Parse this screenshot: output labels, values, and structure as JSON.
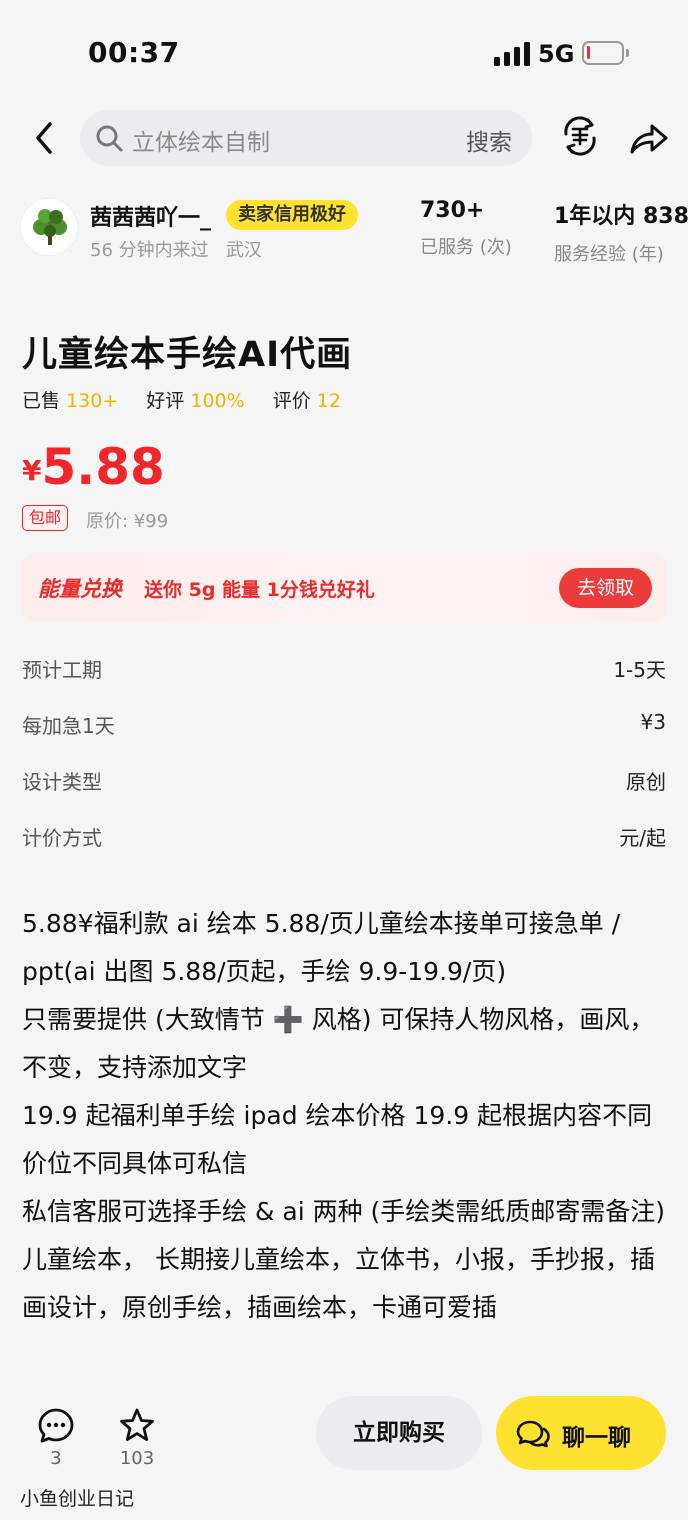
{
  "status_bar": {
    "time": "00:37",
    "network": "5G",
    "battery_level": 0.1
  },
  "search": {
    "placeholder": "立体绘本自制",
    "button_label": "搜索"
  },
  "seller": {
    "name": "茜茜茜吖一_",
    "credit_badge": "卖家信用极好",
    "last_seen": "56 分钟内来过",
    "location": "武汉",
    "served_value": "730+",
    "served_label": "已服务 (次)",
    "experience_value": "1年以内 838",
    "experience_label": "服务经验 (年)"
  },
  "product": {
    "title": "儿童绘本手绘AI代画",
    "sold_label": "已售",
    "sold_value": "130+",
    "rating_label": "好评",
    "rating_value": "100%",
    "reviews_label": "评价",
    "reviews_value": "12",
    "currency": "¥",
    "price": "5.88",
    "free_shipping": "包邮",
    "original_price": "原价: ¥99"
  },
  "energy": {
    "brand": "能量兑换",
    "desc": "送你 5g 能量 1分钱兑好礼",
    "claim_label": "去领取"
  },
  "properties": [
    {
      "key": "预计工期",
      "value": "1-5天"
    },
    {
      "key": "每加急1天",
      "value": "¥3"
    },
    {
      "key": "设计类型",
      "value": "原创"
    },
    {
      "key": "计价方式",
      "value": "元/起"
    }
  ],
  "description": [
    "5.88¥福利款 ai 绘本 5.88/页儿童绘本接单可接急单 / ppt(ai 出图 5.88/页起，手绘 9.9-19.9/页)",
    "只需要提供 (大致情节 ➕ 风格) 可保持人物风格，画风，不变，支持添加文字",
    "19.9 起福利单手绘 ipad 绘本价格 19.9 起根据内容不同价位不同具体可私信",
    "私信客服可选择手绘 & ai 两种 (手绘类需纸质邮寄需备注)",
    "儿童绘本， 长期接儿童绘本，立体书，小报，手抄报，插画设计，原创手绘，插画绘本，卡通可爱插"
  ],
  "bottom": {
    "comments_count": "3",
    "favorites_count": "103",
    "buy_label": "立即购买",
    "chat_label": "聊一聊",
    "watermark": "小鱼创业日记"
  },
  "colors": {
    "price_red": "#f0262a",
    "brand_yellow": "#ffe230",
    "rating_gold": "#f0b400"
  },
  "icons": [
    "back-arrow-icon",
    "search-icon",
    "shop-icon",
    "share-icon",
    "comment-icon",
    "star-icon",
    "chat-bubble-icon"
  ]
}
